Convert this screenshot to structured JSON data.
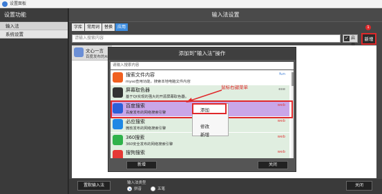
{
  "window": {
    "title": "设置面板"
  },
  "sidebar": {
    "header": "设置功能",
    "items": [
      {
        "label": "输入法"
      },
      {
        "label": "系统设置"
      }
    ]
  },
  "main": {
    "header": "输入法设置",
    "tabs": [
      {
        "label": "字库"
      },
      {
        "label": "常用词"
      },
      {
        "label": "替换"
      },
      {
        "label": "应用"
      }
    ],
    "search_placeholder": "请输入搜索内容",
    "enable_label": "启用",
    "enable_checked": "✓",
    "new_button": "新增",
    "badge": "1",
    "web_tag": "web",
    "card": {
      "name": "文心一言",
      "desc": "百度发布的AI"
    }
  },
  "bottom": {
    "default_im_button": "置默输入法",
    "im_type_label": "输入法类型",
    "options": [
      {
        "label": "拼音",
        "selected": true
      },
      {
        "label": "五笔",
        "selected": false
      }
    ],
    "close_button": "关闭"
  },
  "dialog": {
    "title": "添加到“输入法”操作",
    "search_placeholder": "请输入搜索内容",
    "rows": [
      {
        "name": "搜索文件内容",
        "desc": "myso查用功能，搜索本地电脑文件内容",
        "tag": "fun",
        "tag_color": "#3a7bd5",
        "bg": "#ffffff",
        "icon_color": "#f06020",
        "icon": "search-file-icon"
      },
      {
        "name": "屏幕取色器",
        "desc": "基于Qt实现的强大的开源屏幕取色器。",
        "tag": "exe",
        "tag_color": "#666666",
        "bg": "#e0eee0",
        "icon_color": "#333333",
        "icon": "color-picker-icon"
      },
      {
        "name": "百度搜索",
        "desc": "百度发布的网络搜索引擎",
        "tag": "web",
        "tag_color": "#e04040",
        "bg": "#c9a6e8",
        "icon_color": "#2b5fd9",
        "icon": "baidu-icon"
      },
      {
        "name": "必应搜索",
        "desc": "微软发布的网络搜索引擎",
        "tag": "web",
        "tag_color": "#e04040",
        "bg": "#e0eee0",
        "icon_color": "#1e88e5",
        "icon": "bing-icon"
      },
      {
        "name": "360搜索",
        "desc": "360安全发布的网络搜索引擎",
        "tag": "web",
        "tag_color": "#e04040",
        "bg": "#e0eee0",
        "icon_color": "#2fb24a",
        "icon": "360-icon"
      },
      {
        "name": "搜狗搜索",
        "desc": "",
        "tag": "web",
        "tag_color": "#e04040",
        "bg": "#e0eee0",
        "icon_color": "#e53935",
        "icon": "sogou-icon"
      }
    ],
    "new_button": "新增",
    "close_button": "关闭",
    "context_menu": [
      {
        "label": "添加"
      },
      {
        "label": "修改"
      },
      {
        "label": "新增"
      }
    ],
    "annotation": "鼠标右键菜单"
  }
}
